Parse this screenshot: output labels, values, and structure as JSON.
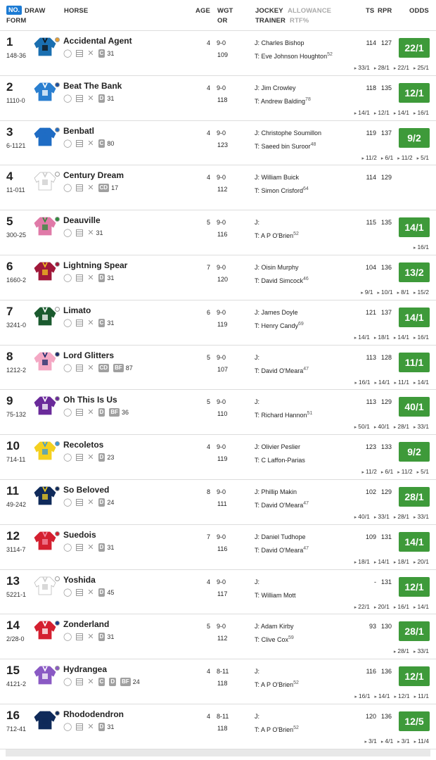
{
  "header": {
    "no": "NO.",
    "draw": "DRAW",
    "form": "FORM",
    "horse": "HORSE",
    "age": "AGE",
    "wgt": "WGT",
    "or": "OR",
    "jockey": "JOCKEY",
    "allowance": "ALLOWANCE",
    "trainer": "TRAINER",
    "rtf": "RTF%",
    "ts": "TS",
    "rpr": "RPR",
    "odds": "ODDS"
  },
  "colors": {
    "odds_green": "#3e9a3a",
    "no_badge_blue": "#1c7bd4"
  },
  "runners": [
    {
      "no": "1",
      "form": "148-36",
      "name": "Accidental Agent",
      "age": "4",
      "wgt": "9-0",
      "or": "109",
      "jockey": "J: Charles Bishop",
      "trainer": "T: Eve Johnson Houghton",
      "rtf": "52",
      "ts": "114",
      "rpr": "127",
      "odds": "22/1",
      "badges": [
        "C"
      ],
      "dsl": "31",
      "hist": [
        "33/1",
        "28/1",
        "22/1",
        "25/1"
      ],
      "silk": "#1a6fb0",
      "silk2": "#111",
      "cap": "#e8a030"
    },
    {
      "no": "2",
      "form": "1110-0",
      "name": "Beat The Bank",
      "age": "4",
      "wgt": "9-0",
      "or": "118",
      "jockey": "J: Jim Crowley",
      "trainer": "T: Andrew Balding",
      "rtf": "78",
      "ts": "118",
      "rpr": "135",
      "odds": "12/1",
      "badges": [
        "D"
      ],
      "dsl": "31",
      "hist": [
        "14/1",
        "12/1",
        "14/1",
        "16/1"
      ],
      "silk": "#2a7fd0",
      "silk2": "#fff",
      "cap": "#1a4fa0"
    },
    {
      "no": "3",
      "form": "6-1121",
      "name": "Benbatl",
      "age": "4",
      "wgt": "9-0",
      "or": "123",
      "jockey": "J: Christophe Soumillon",
      "trainer": "T: Saeed bin Suroor",
      "rtf": "48",
      "ts": "119",
      "rpr": "137",
      "odds": "9/2",
      "badges": [
        "C"
      ],
      "dsl": "80",
      "hist": [
        "11/2",
        "6/1",
        "11/2",
        "5/1"
      ],
      "silk": "#1f6cc4",
      "silk2": "#1f6cc4",
      "cap": "#1f6cc4"
    },
    {
      "no": "4",
      "form": "11-011",
      "name": "Century Dream",
      "age": "4",
      "wgt": "9-0",
      "or": "112",
      "jockey": "J: William Buick",
      "trainer": "T: Simon Crisford",
      "rtf": "64",
      "ts": "114",
      "rpr": "129",
      "odds": "",
      "badges": [
        "CD"
      ],
      "dsl": "17",
      "hist": [],
      "silk": "#fff",
      "silk2": "#ccc",
      "cap": "#fff"
    },
    {
      "no": "5",
      "form": "300-25",
      "name": "Deauville",
      "age": "5",
      "wgt": "9-0",
      "or": "116",
      "jockey": "J:",
      "trainer": "T: A P O'Brien",
      "rtf": "52",
      "ts": "115",
      "rpr": "135",
      "odds": "14/1",
      "badges": [],
      "dsl": "31",
      "hist": [
        "16/1"
      ],
      "silk": "#e07aa8",
      "silk2": "#2e8b3a",
      "cap": "#2e8b3a"
    },
    {
      "no": "6",
      "form": "1660-2",
      "name": "Lightning Spear",
      "age": "7",
      "wgt": "9-0",
      "or": "120",
      "jockey": "J: Oisin Murphy",
      "trainer": "T: David Simcock",
      "rtf": "46",
      "ts": "104",
      "rpr": "136",
      "odds": "13/2",
      "badges": [
        "D"
      ],
      "dsl": "31",
      "hist": [
        "9/1",
        "10/1",
        "8/1",
        "15/2"
      ],
      "silk": "#a0183a",
      "silk2": "#f0c020",
      "cap": "#a0183a"
    },
    {
      "no": "7",
      "form": "3241-0",
      "name": "Limato",
      "age": "6",
      "wgt": "9-0",
      "or": "119",
      "jockey": "J: James Doyle",
      "trainer": "T: Henry Candy",
      "rtf": "69",
      "ts": "121",
      "rpr": "137",
      "odds": "14/1",
      "badges": [
        "C"
      ],
      "dsl": "31",
      "hist": [
        "14/1",
        "18/1",
        "14/1",
        "16/1"
      ],
      "silk": "#1a5a2e",
      "silk2": "#fff",
      "cap": "#fff"
    },
    {
      "no": "8",
      "form": "1212-2",
      "name": "Lord Glitters",
      "age": "5",
      "wgt": "9-0",
      "or": "107",
      "jockey": "J:",
      "trainer": "T: David O'Meara",
      "rtf": "47",
      "ts": "113",
      "rpr": "128",
      "odds": "11/1",
      "badges": [
        "CD",
        "BF"
      ],
      "dsl": "87",
      "hist": [
        "16/1",
        "14/1",
        "11/1",
        "14/1"
      ],
      "silk": "#f4a8c4",
      "silk2": "#1a2a6a",
      "cap": "#1a2a6a"
    },
    {
      "no": "9",
      "form": "75-132",
      "name": "Oh This Is Us",
      "age": "5",
      "wgt": "9-0",
      "or": "110",
      "jockey": "J:",
      "trainer": "T: Richard Hannon",
      "rtf": "51",
      "ts": "113",
      "rpr": "129",
      "odds": "40/1",
      "badges": [
        "D",
        "BF"
      ],
      "dsl": "36",
      "hist": [
        "50/1",
        "40/1",
        "28/1",
        "33/1"
      ],
      "silk": "#6a2a9a",
      "silk2": "#fff",
      "cap": "#6a2a9a"
    },
    {
      "no": "10",
      "form": "714-11",
      "name": "Recoletos",
      "age": "4",
      "wgt": "9-0",
      "or": "119",
      "jockey": "J: Olivier Peslier",
      "trainer": "T: C Laffon-Parias",
      "rtf": "",
      "ts": "123",
      "rpr": "133",
      "odds": "9/2",
      "badges": [
        "D"
      ],
      "dsl": "23",
      "hist": [
        "11/2",
        "6/1",
        "11/2",
        "5/1"
      ],
      "silk": "#f4d020",
      "silk2": "#3a9ad8",
      "cap": "#3a9ad8"
    },
    {
      "no": "11",
      "form": "49-242",
      "name": "So Beloved",
      "age": "8",
      "wgt": "9-0",
      "or": "111",
      "jockey": "J: Phillip Makin",
      "trainer": "T: David O'Meara",
      "rtf": "47",
      "ts": "102",
      "rpr": "129",
      "odds": "28/1",
      "badges": [
        "D"
      ],
      "dsl": "24",
      "hist": [
        "40/1",
        "33/1",
        "28/1",
        "33/1"
      ],
      "silk": "#0f2a5a",
      "silk2": "#f4d020",
      "cap": "#0f2a5a"
    },
    {
      "no": "12",
      "form": "3114-7",
      "name": "Suedois",
      "age": "7",
      "wgt": "9-0",
      "or": "116",
      "jockey": "J: Daniel Tudhope",
      "trainer": "T: David O'Meara",
      "rtf": "47",
      "ts": "109",
      "rpr": "131",
      "odds": "14/1",
      "badges": [
        "D"
      ],
      "dsl": "31",
      "hist": [
        "18/1",
        "14/1",
        "18/1",
        "20/1"
      ],
      "silk": "#d42030",
      "silk2": "#f48aa0",
      "cap": "#d42030"
    },
    {
      "no": "13",
      "form": "5221-1",
      "name": "Yoshida",
      "age": "4",
      "wgt": "9-0",
      "or": "117",
      "jockey": "J:",
      "trainer": "T: William Mott",
      "rtf": "",
      "ts": "-",
      "rpr": "131",
      "odds": "12/1",
      "badges": [
        "D"
      ],
      "dsl": "45",
      "hist": [
        "22/1",
        "20/1",
        "16/1",
        "14/1"
      ],
      "silk": "#fff",
      "silk2": "#ccc",
      "cap": "#fff"
    },
    {
      "no": "14",
      "form": "2/28-0",
      "name": "Zonderland",
      "age": "5",
      "wgt": "9-0",
      "or": "112",
      "jockey": "J: Adam Kirby",
      "trainer": "T: Clive Cox",
      "rtf": "59",
      "ts": "93",
      "rpr": "130",
      "odds": "28/1",
      "badges": [
        "D"
      ],
      "dsl": "31",
      "hist": [
        "28/1",
        "33/1"
      ],
      "silk": "#d42030",
      "silk2": "#fff",
      "cap": "#1a3a8a"
    },
    {
      "no": "15",
      "form": "4121-2",
      "name": "Hydrangea",
      "age": "4",
      "wgt": "8-11",
      "or": "118",
      "jockey": "J:",
      "trainer": "T: A P O'Brien",
      "rtf": "52",
      "ts": "116",
      "rpr": "136",
      "odds": "12/1",
      "badges": [
        "C",
        "D",
        "BF"
      ],
      "dsl": "24",
      "hist": [
        "16/1",
        "14/1",
        "12/1",
        "11/1"
      ],
      "silk": "#8a5ac4",
      "silk2": "#fff",
      "cap": "#8a5ac4"
    },
    {
      "no": "16",
      "form": "712-41",
      "name": "Rhododendron",
      "age": "4",
      "wgt": "8-11",
      "or": "118",
      "jockey": "J:",
      "trainer": "T: A P O'Brien",
      "rtf": "52",
      "ts": "120",
      "rpr": "136",
      "odds": "12/5",
      "badges": [
        "D"
      ],
      "dsl": "31",
      "hist": [
        "3/1",
        "4/1",
        "3/1",
        "11/4"
      ],
      "silk": "#0f2a5a",
      "silk2": "#0f2a5a",
      "cap": "#0f2a5a"
    }
  ]
}
